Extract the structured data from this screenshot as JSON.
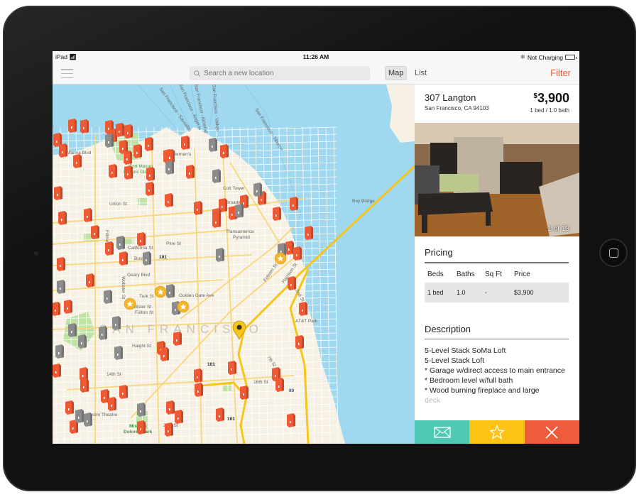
{
  "status_bar": {
    "device": "iPad",
    "time": "11:26 AM",
    "battery": "Not Charging"
  },
  "nav": {
    "search_placeholder": "Search a new location",
    "map_tab": "Map",
    "list_tab": "List",
    "filter": "Filter",
    "active_tab": "Map"
  },
  "map": {
    "city_label": "SAN FRANCISCO",
    "labels": {
      "fort_mason": "Fort Mason",
      "historic": "Historic District",
      "fishermans": "Fisherman's",
      "coit": "Coit Tower",
      "transamerica": "Transamerica",
      "pyramid": "Pyramid",
      "bay_bridge": "Bay Bridge",
      "att_park": "AT&T Park",
      "castro": "Castro Theatre",
      "mission": "Mission",
      "dolores": "Dolores Park",
      "marina": "Marina Blvd",
      "union": "Union St",
      "broadway": "Broadway",
      "california": "California St",
      "pine": "Pine St",
      "bush": "Bush St",
      "geary": "Geary Blvd",
      "turk": "Turk St",
      "golden_gate": "Golden Gate Ave",
      "fulton": "Fulton St",
      "mcallister": "McAllister St",
      "haight": "Haight St",
      "fourteenth": "14th St",
      "sixteenth": "16th St",
      "twentieth": "20th St",
      "folsom": "Folsom St",
      "harrison": "Harrison St",
      "second": "2nd St",
      "seventh": "7th St",
      "webster": "Webster St",
      "fillmore": "Fillmore St",
      "ferry_sausalito": "San Francisco - Sausalito",
      "ferry_angel": "San Francisco - Angel Is",
      "ferry_alcatraz": "San Francisco - Alcatraz",
      "ferry_vallejo": "San Francisco - Vallejo",
      "ferry_tiburon": "San Francisco - Tiburon",
      "hwy101": "101",
      "hwy101b": "101",
      "hwy101c": "101",
      "i80": "80"
    },
    "colors": {
      "water": "#9fd8ef",
      "land": "#f6f1e4",
      "park": "#bfe3a6",
      "road": "#f7d77a",
      "highway": "#f6c51a",
      "pin_available": "#ef5a35",
      "pin_unavailable": "#8c8c8c",
      "favorite": "#f5b52a"
    }
  },
  "listing": {
    "address": "307 Langton",
    "city": "San Francisco, CA 94103",
    "price_symbol": "$",
    "price": "3,900",
    "beds_baths": "1 bed / 1.0 bath",
    "photo_counter": "1 of 13",
    "pricing_title": "Pricing",
    "pricing_headers": [
      "Beds",
      "Baths",
      "Sq Ft",
      "Price"
    ],
    "pricing_rows": [
      [
        "1 bed",
        "1.0",
        "-",
        "$3,900"
      ]
    ],
    "description_title": "Description",
    "description_lines": [
      "5-Level Stack SoMa Loft",
      "5-Level Stack Loft",
      "* Garage w/direct access to main entrance",
      "* Bedroom level w/full bath",
      "* Wood burning fireplace and large",
      "deck"
    ]
  },
  "actions": {
    "email": {
      "icon": "envelope-icon",
      "color": "#4ec9b4"
    },
    "favorite": {
      "icon": "star-icon",
      "color": "#fcc314"
    },
    "dismiss": {
      "icon": "close-icon",
      "color": "#ee5b3d"
    }
  }
}
